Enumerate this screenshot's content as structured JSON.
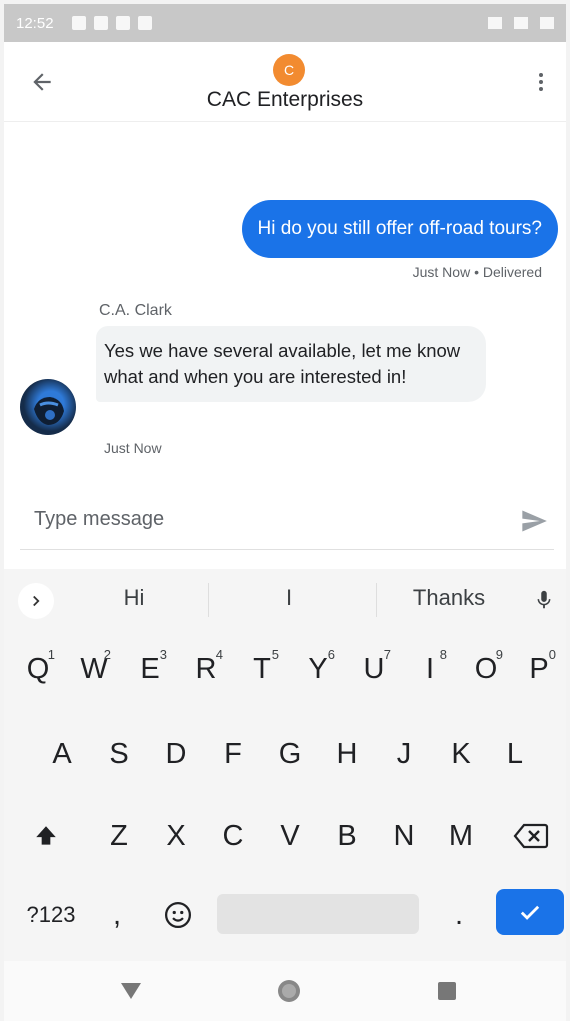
{
  "status_bar": {
    "time": "12:52"
  },
  "header": {
    "avatar_letter": "C",
    "title": "CAC Enterprises"
  },
  "messages": {
    "outgoing": {
      "text": "Hi do you still offer off-road tours?",
      "meta": "Just Now • Delivered"
    },
    "incoming": {
      "sender": "C.A. Clark",
      "text": "Yes we have several available, let me know what and when you are interested in!",
      "meta": "Just Now"
    }
  },
  "compose": {
    "placeholder": "Type message"
  },
  "keyboard": {
    "suggestions": [
      "Hi",
      "I",
      "Thanks"
    ],
    "row1": [
      {
        "key": "Q",
        "hint": "1"
      },
      {
        "key": "W",
        "hint": "2"
      },
      {
        "key": "E",
        "hint": "3"
      },
      {
        "key": "R",
        "hint": "4"
      },
      {
        "key": "T",
        "hint": "5"
      },
      {
        "key": "Y",
        "hint": "6"
      },
      {
        "key": "U",
        "hint": "7"
      },
      {
        "key": "I",
        "hint": "8"
      },
      {
        "key": "O",
        "hint": "9"
      },
      {
        "key": "P",
        "hint": "0"
      }
    ],
    "row2": [
      "A",
      "S",
      "D",
      "F",
      "G",
      "H",
      "J",
      "K",
      "L"
    ],
    "row3": [
      "Z",
      "X",
      "C",
      "V",
      "B",
      "N",
      "M"
    ],
    "symbols_key": "?123",
    "comma_key": ",",
    "period_key": "."
  },
  "colors": {
    "accent": "#1a73e8",
    "avatar": "#f28b30",
    "bubble_in": "#f1f3f4"
  },
  "icons": [
    "back-arrow-icon",
    "more-vert-icon",
    "send-icon",
    "chevron-right-icon",
    "mic-icon",
    "shift-icon",
    "backspace-icon",
    "emoji-icon",
    "check-icon",
    "nav-back-icon",
    "nav-home-icon",
    "nav-recents-icon"
  ]
}
